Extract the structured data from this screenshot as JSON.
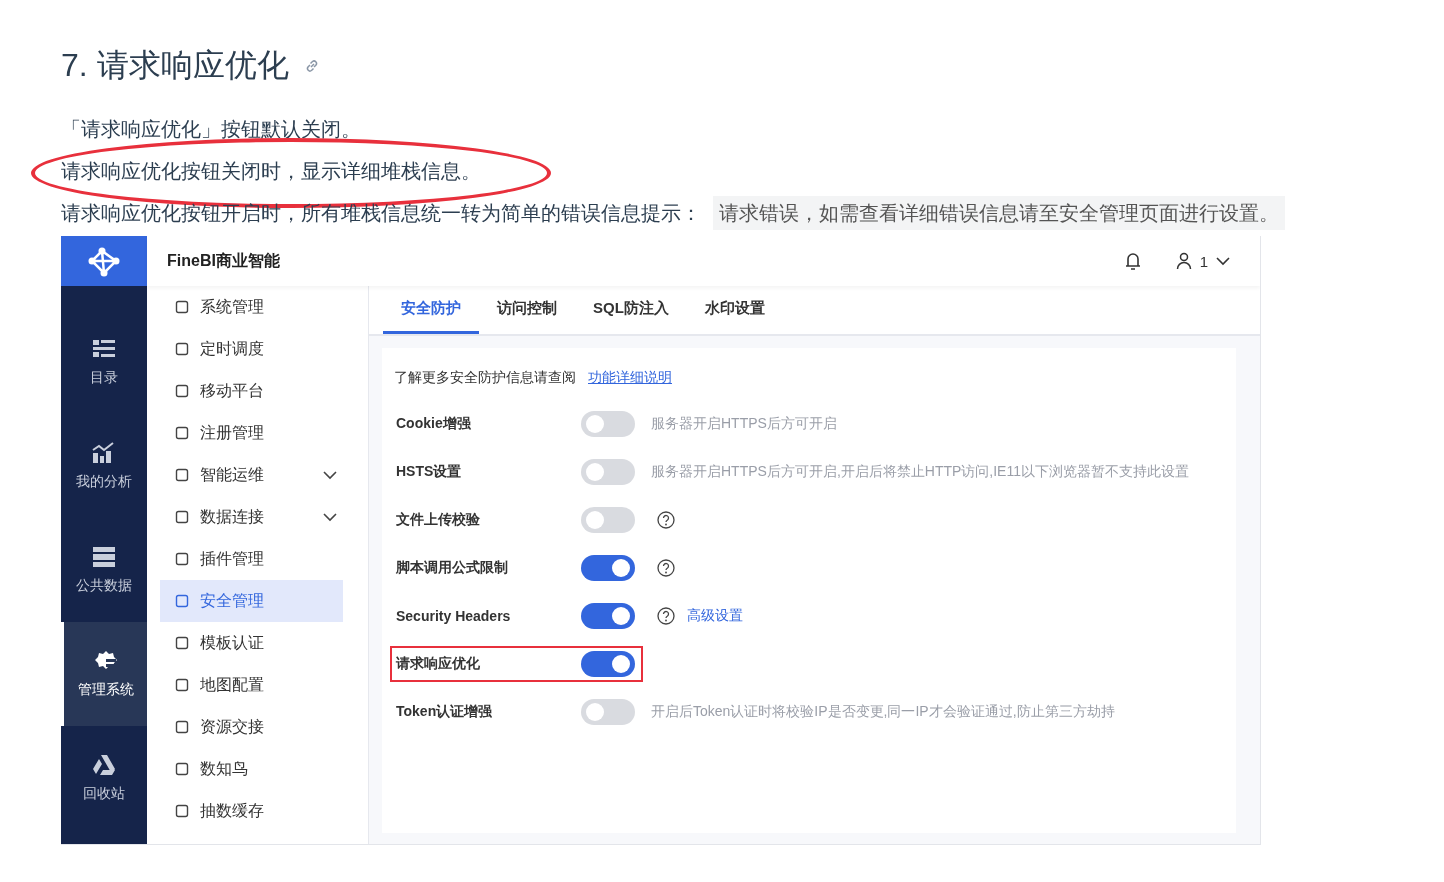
{
  "doc": {
    "heading": "7. 请求响应优化",
    "paragraphs": [
      {
        "text": "「请求响应优化」按钮默认关闭。",
        "circled": false
      },
      {
        "text": "请求响应优化按钮关闭时，显示详细堆栈信息。",
        "circled": true
      },
      {
        "text": "请求响应优化按钮开启时，所有堆栈信息统一转为简单的错误信息提示：",
        "code": "请求错误，如需查看详细错误信息请至安全管理页面进行设置。",
        "circled": false
      }
    ]
  },
  "app": {
    "title": "FineBI商业智能",
    "user": "1",
    "nav": [
      {
        "label": "目录",
        "selected": false
      },
      {
        "label": "我的分析",
        "selected": false
      },
      {
        "label": "公共数据",
        "selected": false
      },
      {
        "label": "管理系统",
        "selected": true
      },
      {
        "label": "回收站",
        "selected": false
      }
    ],
    "menu": [
      {
        "label": "系统管理",
        "expandable": false,
        "selected": false
      },
      {
        "label": "定时调度",
        "expandable": false,
        "selected": false
      },
      {
        "label": "移动平台",
        "expandable": false,
        "selected": false
      },
      {
        "label": "注册管理",
        "expandable": false,
        "selected": false
      },
      {
        "label": "智能运维",
        "expandable": true,
        "selected": false
      },
      {
        "label": "数据连接",
        "expandable": true,
        "selected": false
      },
      {
        "label": "插件管理",
        "expandable": false,
        "selected": false
      },
      {
        "label": "安全管理",
        "expandable": false,
        "selected": true
      },
      {
        "label": "模板认证",
        "expandable": false,
        "selected": false
      },
      {
        "label": "地图配置",
        "expandable": false,
        "selected": false
      },
      {
        "label": "资源交接",
        "expandable": false,
        "selected": false
      },
      {
        "label": "数知鸟",
        "expandable": false,
        "selected": false
      },
      {
        "label": "抽数缓存",
        "expandable": false,
        "selected": false
      }
    ],
    "tabs": [
      {
        "label": "安全防护",
        "selected": true
      },
      {
        "label": "访问控制",
        "selected": false
      },
      {
        "label": "SQL防注入",
        "selected": false
      },
      {
        "label": "水印设置",
        "selected": false
      }
    ],
    "intro": {
      "text": "了解更多安全防护信息请查阅",
      "link": "功能详细说明"
    },
    "settings": [
      {
        "label": "Cookie增强",
        "on": false,
        "help": false,
        "note": "服务器开启HTTPS后方可开启",
        "highlighted": false
      },
      {
        "label": "HSTS设置",
        "on": false,
        "help": false,
        "note": "服务器开启HTTPS后方可开启,开启后将禁止HTTP访问,IE11以下浏览器暂不支持此设置",
        "highlighted": false
      },
      {
        "label": "文件上传校验",
        "on": false,
        "help": true,
        "highlighted": false
      },
      {
        "label": "脚本调用公式限制",
        "on": true,
        "help": true,
        "highlighted": false
      },
      {
        "label": "Security Headers",
        "on": true,
        "help": true,
        "link": "高级设置",
        "highlighted": false
      },
      {
        "label": "请求响应优化",
        "on": true,
        "help": false,
        "highlighted": true
      },
      {
        "label": "Token认证增强",
        "on": false,
        "help": false,
        "note": "开启后Token认证时将校验IP是否变更,同一IP才会验证通过,防止第三方劫持",
        "highlighted": false
      }
    ]
  }
}
